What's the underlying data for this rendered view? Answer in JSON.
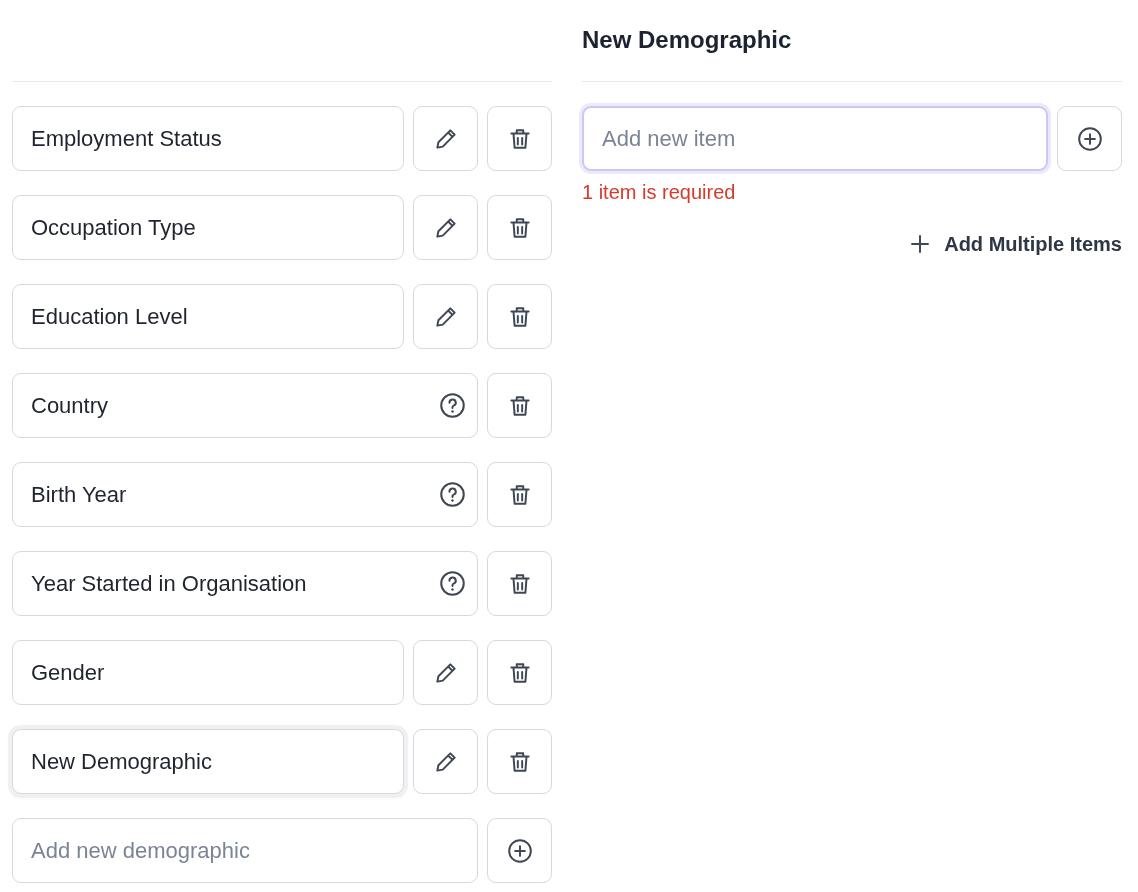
{
  "demographics": [
    {
      "label": "Employment Status",
      "kind": "editable",
      "selected": false
    },
    {
      "label": "Occupation Type",
      "kind": "editable",
      "selected": false
    },
    {
      "label": "Education Level",
      "kind": "editable",
      "selected": false
    },
    {
      "label": "Country",
      "kind": "locked",
      "selected": false
    },
    {
      "label": "Birth Year",
      "kind": "locked",
      "selected": false
    },
    {
      "label": "Year Started in Organisation",
      "kind": "locked",
      "selected": false
    },
    {
      "label": "Gender",
      "kind": "editable",
      "selected": false
    },
    {
      "label": "New Demographic",
      "kind": "editable",
      "selected": true
    }
  ],
  "new_demographic_field": {
    "placeholder": "Add new demographic"
  },
  "detail": {
    "title": "New Demographic",
    "item_field": {
      "placeholder": "Add new item",
      "focused": true
    },
    "error": "1 item is required",
    "add_multiple_link": "Add Multiple Items"
  }
}
